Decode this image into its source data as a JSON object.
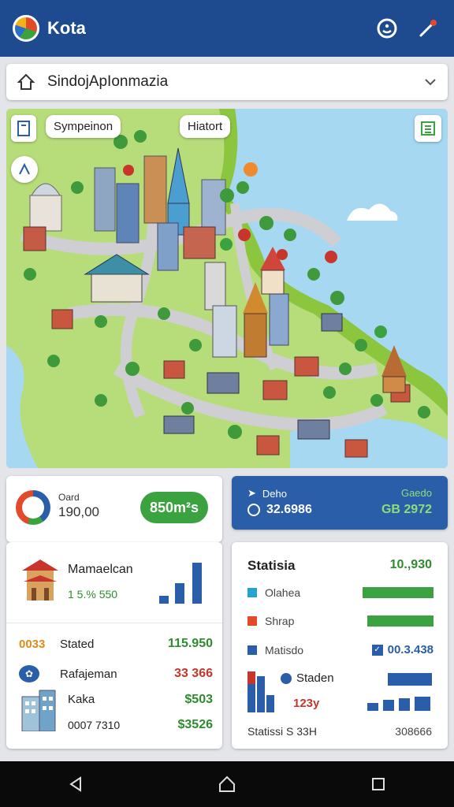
{
  "app": {
    "title": "Kota"
  },
  "search": {
    "value": "SindojApIonmazia"
  },
  "map": {
    "labels": {
      "left": "Sympeinon",
      "right": "Hiatort"
    }
  },
  "summary_card": {
    "label": "Oard",
    "value": "190,00",
    "pill": "850m²s"
  },
  "blue_card": {
    "left_label": "Deho",
    "left_value": "32.6986",
    "right_label": "Gaedo",
    "right_value": "GB 2972"
  },
  "left_list": {
    "top_item": {
      "title": "Mamaelcan",
      "values": "1 5.% 550"
    },
    "rows": [
      {
        "badge": "0033",
        "label": "Stated",
        "value": "115.950",
        "value_color": "#2e8b2e"
      },
      {
        "label": "Rafajeman",
        "value": "33 366",
        "value_color": "#c7352b"
      },
      {
        "label": "Kaka",
        "value": "$503",
        "value_color": "#2e8b2e"
      },
      {
        "label": "0007 7310",
        "value": "$3526",
        "value_color": "#2e8b2e"
      }
    ]
  },
  "stats_card": {
    "title": "Statisia",
    "title_value": "10.,930",
    "rows": [
      {
        "label": "Olahea",
        "marker_color": "#2aa1c9",
        "bar_fill": 0.7,
        "bar_color": "#3aa23e"
      },
      {
        "label": "Shrap",
        "marker_color": "#e24a2b",
        "bar_fill": 0.66,
        "bar_color": "#3aa23e"
      },
      {
        "label": "Matisdo",
        "value": "00.3.438",
        "marker_color": "#2a5ea8"
      }
    ],
    "chart": {
      "label": "Staden",
      "sub_value": "123y",
      "bars": [
        0.95,
        0.75,
        0.4
      ],
      "right_bars_fill": [
        0.63
      ]
    },
    "footer_label": "Statissi S 33H",
    "footer_value": "308666"
  },
  "colors": {
    "appbar": "#1e4b8f",
    "accent_green": "#3aa23e",
    "accent_blue": "#2a5ea8",
    "blue_card": "#2a5ea8"
  }
}
